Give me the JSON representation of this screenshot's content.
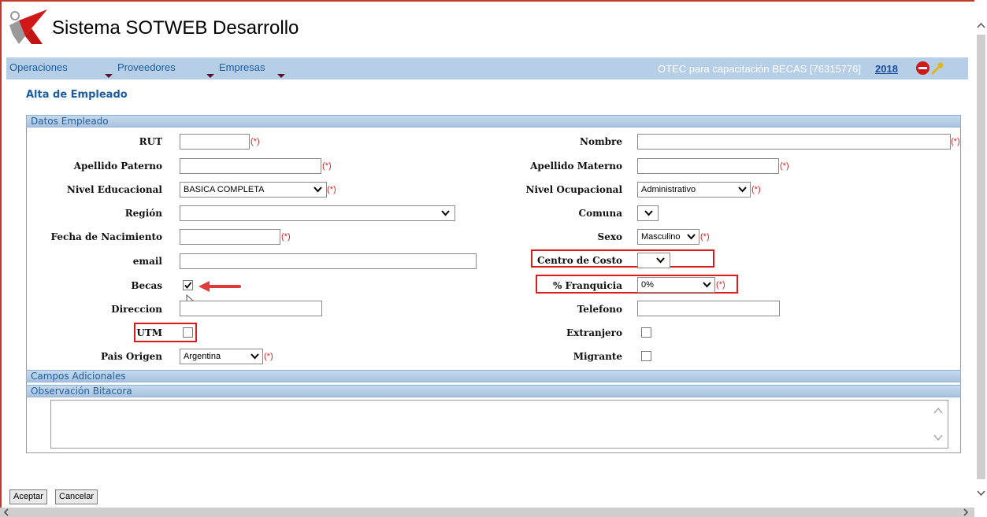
{
  "app": {
    "title": "Sistema SOTWEB Desarrollo"
  },
  "menu": {
    "items": [
      {
        "label": "Operaciones"
      },
      {
        "label": "Proveedores"
      },
      {
        "label": "Empresas"
      }
    ],
    "org": "OTEC para capacitación BECAS [76315776]",
    "year": "2018"
  },
  "page": {
    "title": "Alta de Empleado"
  },
  "sections": {
    "datos": "Datos Empleado",
    "campos": "Campos Adicionales",
    "observacion": "Observación Bitacora"
  },
  "required_mark": "(*)",
  "form": {
    "rut": {
      "label": "RUT",
      "value": ""
    },
    "nombre": {
      "label": "Nombre",
      "value": ""
    },
    "apellido_paterno": {
      "label": "Apellido Paterno",
      "value": ""
    },
    "apellido_materno": {
      "label": "Apellido Materno",
      "value": ""
    },
    "nivel_educacional": {
      "label": "Nivel Educacional",
      "selected": "BASICA COMPLETA"
    },
    "nivel_ocupacional": {
      "label": "Nivel Ocupacional",
      "selected": "Administrativo"
    },
    "region": {
      "label": "Región",
      "selected": ""
    },
    "comuna": {
      "label": "Comuna",
      "selected": ""
    },
    "fecha_nacimiento": {
      "label": "Fecha de Nacimiento",
      "value": ""
    },
    "sexo": {
      "label": "Sexo",
      "selected": "Masculino"
    },
    "email": {
      "label": "email",
      "value": ""
    },
    "centro_costo": {
      "label": "Centro de Costo",
      "selected": ""
    },
    "becas": {
      "label": "Becas",
      "checked": true
    },
    "franquicia": {
      "label": "% Franquicia",
      "selected": "0%"
    },
    "direccion": {
      "label": "Direccion",
      "value": ""
    },
    "telefono": {
      "label": "Telefono",
      "value": ""
    },
    "utm": {
      "label": "UTM",
      "checked": false
    },
    "extranjero": {
      "label": "Extranjero",
      "checked": false
    },
    "pais_origen": {
      "label": "Pais Origen",
      "selected": "Argentina"
    },
    "migrante": {
      "label": "Migrante",
      "checked": false
    }
  },
  "buttons": {
    "aceptar": "Aceptar",
    "cancelar": "Cancelar"
  },
  "colors": {
    "menubar": "#b7cfe6",
    "link": "#1a5da3",
    "highlight": "#d81c1c",
    "required": "#e01f1f"
  }
}
